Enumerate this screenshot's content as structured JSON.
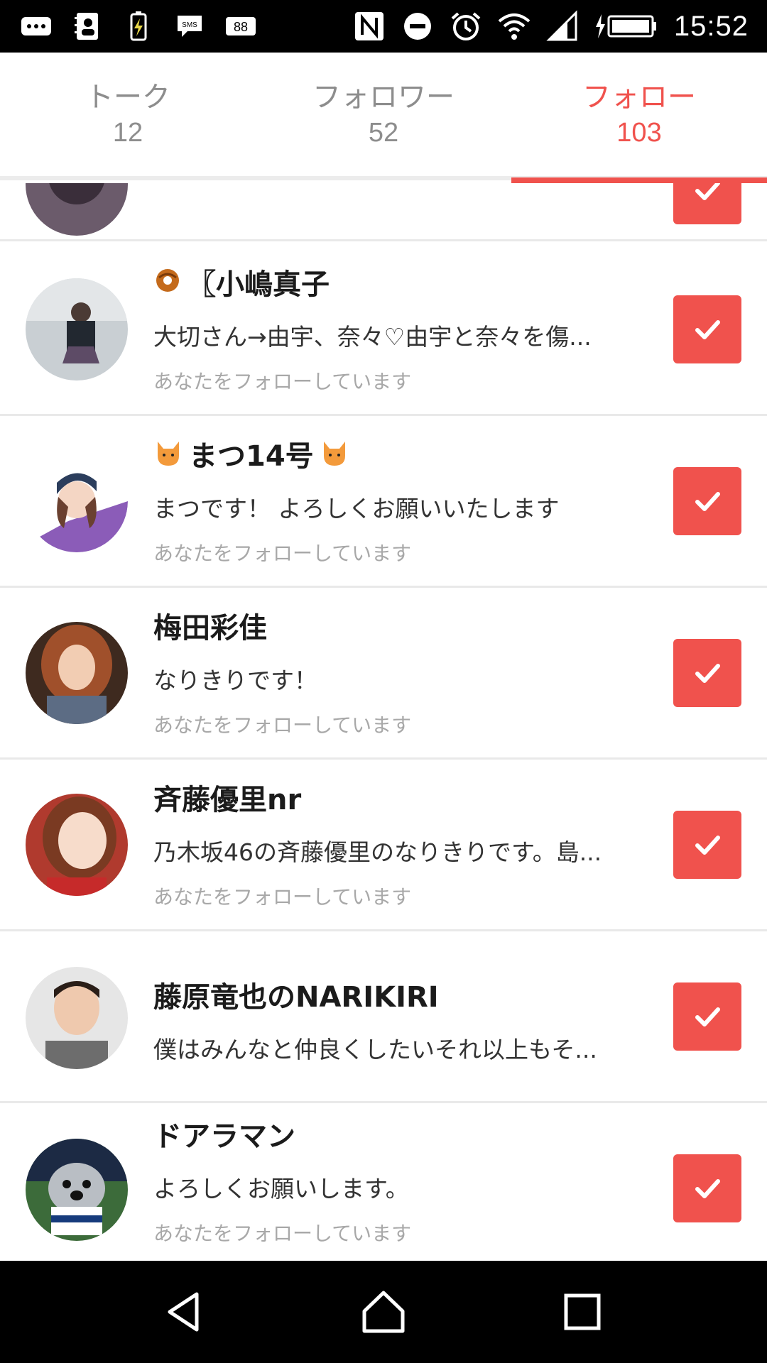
{
  "status_bar": {
    "clock": "15:52",
    "notification_badge": "88",
    "sms_label": "SMS",
    "left_icons": [
      "more-icon",
      "contact-card-icon",
      "battery-charging-icon",
      "sms-icon",
      "badge-88-icon"
    ],
    "right_icons": [
      "nfc-icon",
      "do-not-disturb-icon",
      "alarm-icon",
      "wifi-icon",
      "cell-signal-icon",
      "battery-charging-icon"
    ]
  },
  "tabs": [
    {
      "label": "トーク",
      "count": "12",
      "active": false
    },
    {
      "label": "フォロワー",
      "count": "52",
      "active": false
    },
    {
      "label": "フォロー",
      "count": "103",
      "active": true
    }
  ],
  "users": [
    {
      "name": "〖小嶋真子",
      "name_prefix_icon": "donut-icon",
      "bio": "大切さん→由宇、奈々♡由宇と奈々を傷...",
      "status": "あなたをフォローしています",
      "following": true
    },
    {
      "name": "まつ14号",
      "name_prefix_icon": "cat-icon",
      "name_suffix_icon": "cat-icon",
      "bio": "まつです！ よろしくお願いいたします",
      "status": "あなたをフォローしています",
      "following": true
    },
    {
      "name": "梅田彩佳",
      "bio": "なりきりです！",
      "status": "あなたをフォローしています",
      "following": true
    },
    {
      "name": "斉藤優里nr",
      "bio": "乃木坂46の斉藤優里のなりきりです。島...",
      "status": "あなたをフォローしています",
      "following": true
    },
    {
      "name": "藤原竜也のNARIKIRI",
      "bio": "僕はみんなと仲良くしたいそれ以上もそ...",
      "following": true
    },
    {
      "name": "ドアラマン",
      "bio": "よろしくお願いします。",
      "status": "あなたをフォローしています",
      "following": true
    }
  ],
  "nav_bar": {
    "buttons": [
      "back-icon",
      "home-icon",
      "recents-icon"
    ]
  },
  "colors": {
    "accent": "#f0524d",
    "tab_inactive": "#8d8d8d",
    "subtext": "#a8a8a8"
  }
}
